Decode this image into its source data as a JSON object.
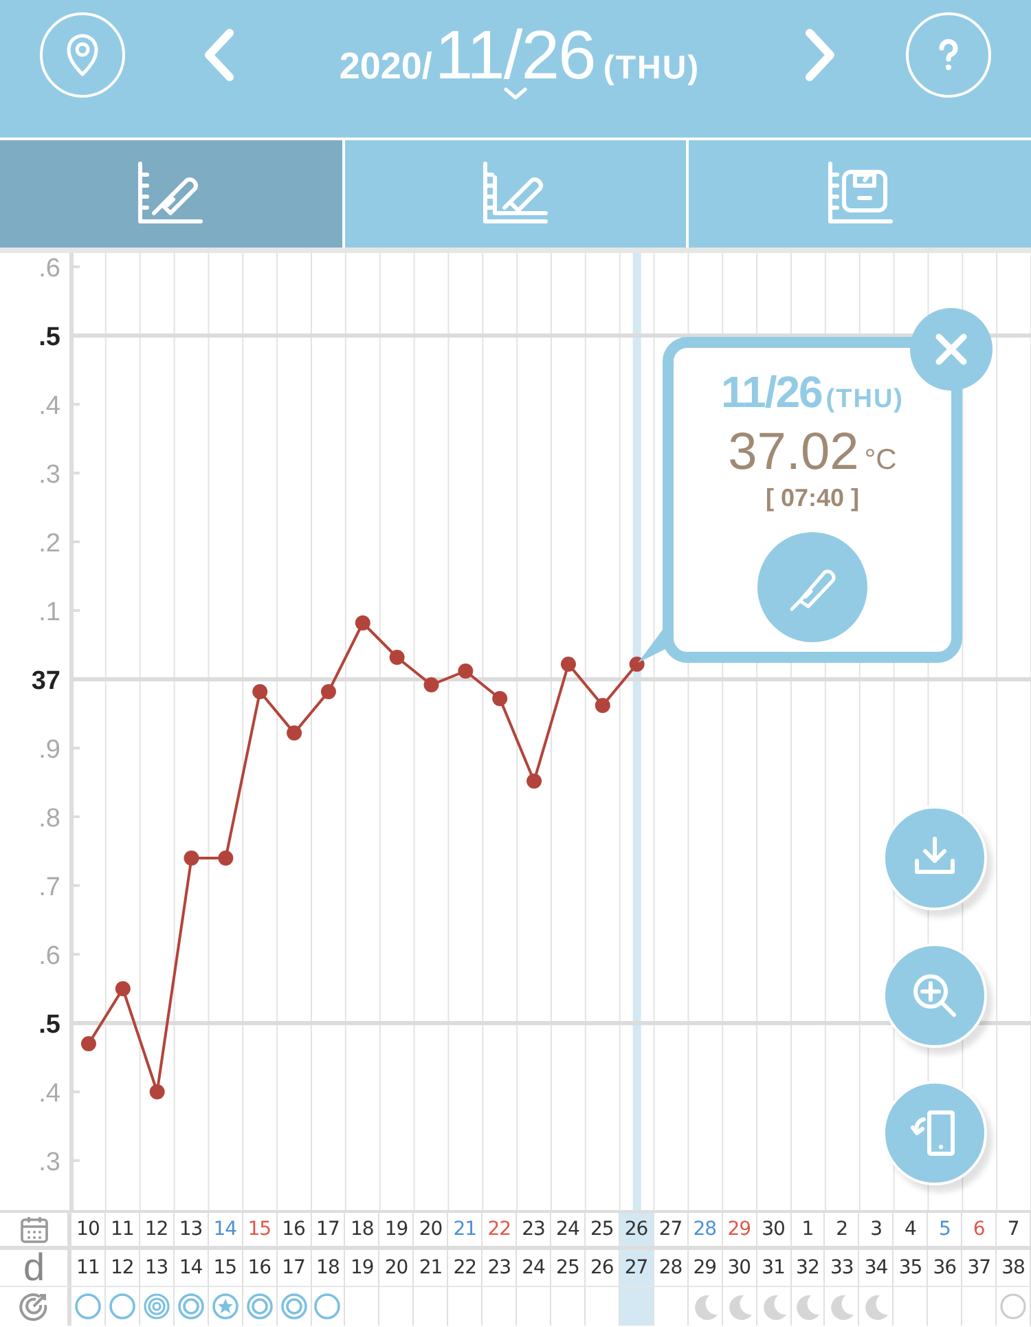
{
  "header": {
    "year": "2020/",
    "date": "11/26",
    "weekday": "(THU)"
  },
  "tabs": [
    {
      "kind": "temperature",
      "selected": true
    },
    {
      "kind": "temperature_detail",
      "selected": false
    },
    {
      "kind": "weight",
      "selected": false
    }
  ],
  "y_axis_labels": [
    {
      "label": ".6",
      "major": false
    },
    {
      "label": ".5",
      "major": true
    },
    {
      "label": ".4",
      "major": false
    },
    {
      "label": ".3",
      "major": false
    },
    {
      "label": ".2",
      "major": false
    },
    {
      "label": ".1",
      "major": false
    },
    {
      "label": "37",
      "major": true
    },
    {
      "label": ".9",
      "major": false
    },
    {
      "label": ".8",
      "major": false
    },
    {
      "label": ".7",
      "major": false
    },
    {
      "label": ".6",
      "major": false
    },
    {
      "label": ".5",
      "major": true
    },
    {
      "label": ".4",
      "major": false
    },
    {
      "label": ".3",
      "major": false
    }
  ],
  "popup": {
    "date": "11/26",
    "weekday": "(THU)",
    "temperature": "37.02",
    "unit": "°C",
    "time": "[ 07:40 ]"
  },
  "days": [
    {
      "date": "10",
      "cycle_day": "11",
      "color": "#333333",
      "kind": "circle",
      "selected": false
    },
    {
      "date": "11",
      "cycle_day": "12",
      "color": "#333333",
      "kind": "circle",
      "selected": false
    },
    {
      "date": "12",
      "cycle_day": "13",
      "color": "#333333",
      "kind": "target",
      "selected": false
    },
    {
      "date": "13",
      "cycle_day": "14",
      "color": "#333333",
      "kind": "double",
      "selected": false
    },
    {
      "date": "14",
      "cycle_day": "15",
      "color": "#4a90d9",
      "kind": "star",
      "selected": false
    },
    {
      "date": "15",
      "cycle_day": "16",
      "color": "#e0574a",
      "kind": "double",
      "selected": false
    },
    {
      "date": "16",
      "cycle_day": "17",
      "color": "#333333",
      "kind": "double",
      "selected": false
    },
    {
      "date": "17",
      "cycle_day": "18",
      "color": "#333333",
      "kind": "circle",
      "selected": false
    },
    {
      "date": "18",
      "cycle_day": "19",
      "color": "#333333",
      "kind": "none",
      "selected": false
    },
    {
      "date": "19",
      "cycle_day": "20",
      "color": "#333333",
      "kind": "none",
      "selected": false
    },
    {
      "date": "20",
      "cycle_day": "21",
      "color": "#333333",
      "kind": "none",
      "selected": false
    },
    {
      "date": "21",
      "cycle_day": "22",
      "color": "#4a90d9",
      "kind": "none",
      "selected": false
    },
    {
      "date": "22",
      "cycle_day": "23",
      "color": "#e0574a",
      "kind": "none",
      "selected": false
    },
    {
      "date": "23",
      "cycle_day": "24",
      "color": "#333333",
      "kind": "none",
      "selected": false
    },
    {
      "date": "24",
      "cycle_day": "25",
      "color": "#333333",
      "kind": "none",
      "selected": false
    },
    {
      "date": "25",
      "cycle_day": "26",
      "color": "#333333",
      "kind": "none",
      "selected": false
    },
    {
      "date": "26",
      "cycle_day": "27",
      "color": "#333333",
      "kind": "none",
      "selected": true
    },
    {
      "date": "27",
      "cycle_day": "28",
      "color": "#333333",
      "kind": "none",
      "selected": false
    },
    {
      "date": "28",
      "cycle_day": "29",
      "color": "#4a90d9",
      "kind": "moon",
      "selected": false
    },
    {
      "date": "29",
      "cycle_day": "30",
      "color": "#e0574a",
      "kind": "moon",
      "selected": false
    },
    {
      "date": "30",
      "cycle_day": "31",
      "color": "#333333",
      "kind": "moon",
      "selected": false
    },
    {
      "date": "1",
      "cycle_day": "32",
      "color": "#333333",
      "kind": "moon",
      "selected": false
    },
    {
      "date": "2",
      "cycle_day": "33",
      "color": "#333333",
      "kind": "moon",
      "selected": false
    },
    {
      "date": "3",
      "cycle_day": "34",
      "color": "#333333",
      "kind": "moon",
      "selected": false
    },
    {
      "date": "4",
      "cycle_day": "35",
      "color": "#333333",
      "kind": "none",
      "selected": false
    },
    {
      "date": "5",
      "cycle_day": "36",
      "color": "#4a90d9",
      "kind": "none",
      "selected": false
    },
    {
      "date": "6",
      "cycle_day": "37",
      "color": "#e0574a",
      "kind": "none",
      "selected": false
    },
    {
      "date": "7",
      "cycle_day": "38",
      "color": "#333333",
      "kind": "gray_circle",
      "selected": false
    }
  ],
  "cycle_day_label": "d"
}
